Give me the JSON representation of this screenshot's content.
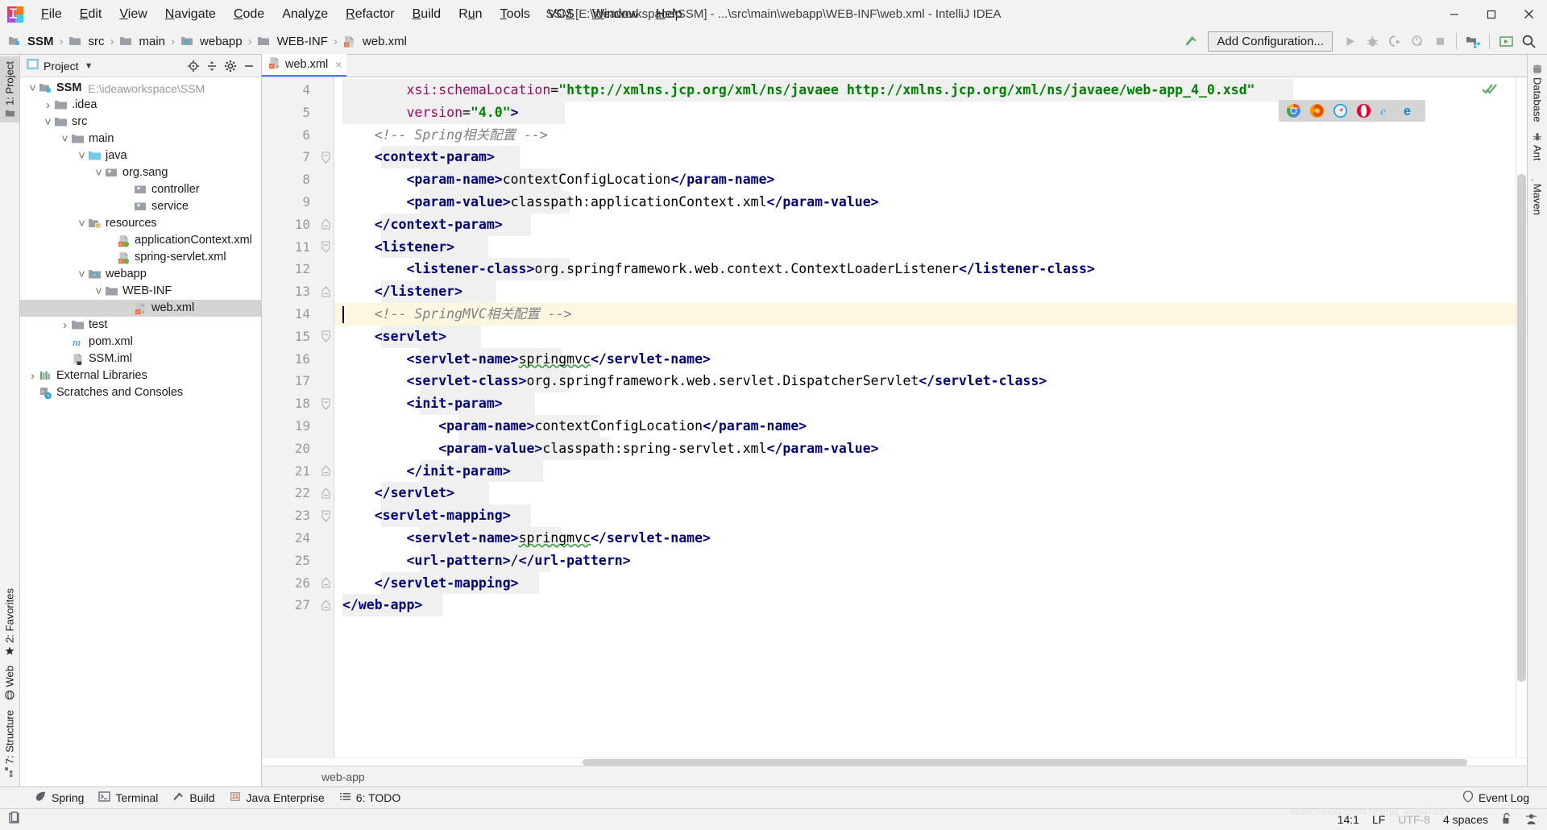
{
  "window": {
    "title": "SSM [E:\\ideaworkspace\\SSM] - ...\\src\\main\\webapp\\WEB-INF\\web.xml - IntelliJ IDEA",
    "minimize_label": "Minimize",
    "maximize_label": "Maximize",
    "close_label": "Close"
  },
  "menu": [
    {
      "label": "File"
    },
    {
      "label": "Edit"
    },
    {
      "label": "View"
    },
    {
      "label": "Navigate"
    },
    {
      "label": "Code"
    },
    {
      "label": "Analyze"
    },
    {
      "label": "Refactor"
    },
    {
      "label": "Build"
    },
    {
      "label": "Run"
    },
    {
      "label": "Tools"
    },
    {
      "label": "VCS"
    },
    {
      "label": "Window"
    },
    {
      "label": "Help"
    }
  ],
  "navbar": {
    "crumbs": [
      {
        "label": "SSM",
        "icon": "module-icon"
      },
      {
        "label": "src",
        "icon": "folder-icon"
      },
      {
        "label": "main",
        "icon": "folder-icon"
      },
      {
        "label": "webapp",
        "icon": "webapp-folder-icon"
      },
      {
        "label": "WEB-INF",
        "icon": "folder-icon"
      },
      {
        "label": "web.xml",
        "icon": "xml-file-icon"
      }
    ],
    "separator": "›",
    "add_configuration": "Add Configuration...",
    "icons": [
      "hammer-build-icon",
      "run-icon",
      "debug-icon",
      "run-coverage-icon",
      "profile-icon",
      "stop-icon",
      "project-structure-icon",
      "update-running-app-icon",
      "search-everywhere-icon"
    ]
  },
  "left_strip": [
    {
      "label": "1: Project",
      "active": true,
      "icon": "project-icon"
    },
    {
      "label": "2: Favorites",
      "active": false,
      "icon": "star-icon"
    },
    {
      "label": "Web",
      "active": false,
      "icon": "web-icon"
    },
    {
      "label": "7: Structure",
      "active": false,
      "icon": "structure-icon"
    }
  ],
  "right_strip": [
    {
      "label": "Database",
      "icon": "database-icon"
    },
    {
      "label": "Ant",
      "icon": "ant-icon"
    },
    {
      "label": "Maven",
      "icon": "maven-icon"
    }
  ],
  "project_panel": {
    "title": "Project",
    "tools": [
      "locate-icon",
      "collapse-all-icon",
      "settings-gear-icon",
      "hide-icon"
    ],
    "tree": [
      {
        "depth": 0,
        "label": "SSM",
        "path": "E:\\ideaworkspace\\SSM",
        "icon": "module-icon",
        "arrow": "expanded",
        "bold": true
      },
      {
        "depth": 1,
        "label": ".idea",
        "icon": "folder-icon",
        "arrow": "collapsed"
      },
      {
        "depth": 1,
        "label": "src",
        "icon": "folder-icon",
        "arrow": "expanded"
      },
      {
        "depth": 2,
        "label": "main",
        "icon": "folder-icon",
        "arrow": "expanded"
      },
      {
        "depth": 3,
        "label": "java",
        "icon": "source-folder-icon",
        "arrow": "expanded"
      },
      {
        "depth": 4,
        "label": "org.sang",
        "icon": "package-icon",
        "arrow": "expanded"
      },
      {
        "depth": 5,
        "label": "controller",
        "icon": "package-icon",
        "arrow": "none"
      },
      {
        "depth": 5,
        "label": "service",
        "icon": "package-icon",
        "arrow": "none"
      },
      {
        "depth": 3,
        "label": "resources",
        "icon": "resources-folder-icon",
        "arrow": "expanded"
      },
      {
        "depth": 4,
        "label": "applicationContext.xml",
        "icon": "spring-xml-icon",
        "arrow": "none"
      },
      {
        "depth": 4,
        "label": "spring-servlet.xml",
        "icon": "spring-xml-icon",
        "arrow": "none"
      },
      {
        "depth": 3,
        "label": "webapp",
        "icon": "webapp-folder-icon",
        "arrow": "expanded"
      },
      {
        "depth": 4,
        "label": "WEB-INF",
        "icon": "folder-icon",
        "arrow": "expanded"
      },
      {
        "depth": 5,
        "label": "web.xml",
        "icon": "web-xml-icon",
        "arrow": "none",
        "selected": true
      },
      {
        "depth": 2,
        "label": "test",
        "icon": "folder-icon",
        "arrow": "collapsed"
      },
      {
        "depth": 1,
        "label": "pom.xml",
        "icon": "maven-pom-icon",
        "arrow": "none"
      },
      {
        "depth": 1,
        "label": "SSM.iml",
        "icon": "iml-file-icon",
        "arrow": "none"
      },
      {
        "depth": 0,
        "label": "External Libraries",
        "icon": "libraries-icon",
        "arrow": "collapsed"
      },
      {
        "depth": 0,
        "label": "Scratches and Consoles",
        "icon": "scratches-icon",
        "arrow": "none"
      }
    ]
  },
  "editor": {
    "tab": {
      "label": "web.xml",
      "icon": "web-xml-icon",
      "close": "×"
    },
    "caret_line": 14,
    "first_line": 4,
    "breadcrumb": "web-app",
    "browser_popup": [
      "chrome-icon",
      "firefox-icon",
      "safari-icon",
      "opera-icon",
      "ie-icon",
      "edge-icon"
    ],
    "inspection_badge": "inspections-ok-icon",
    "lines": [
      {
        "n": 4,
        "fold": "none",
        "indent_hl": [
          0,
          1180
        ],
        "spans": [
          {
            "t": "        ",
            "c": "plain"
          },
          {
            "t": "xsi:schemaLocation",
            "c": "attr"
          },
          {
            "t": "=",
            "c": "plain"
          },
          {
            "t": "\"http://xmlns.jcp.org/xml/ns/javaee http://xmlns.jcp.org/xml/ns/javaee/web-app_4_0.xsd\"",
            "c": "str"
          }
        ]
      },
      {
        "n": 5,
        "fold": "none",
        "indent_hl": [
          0,
          276
        ],
        "spans": [
          {
            "t": "        ",
            "c": "plain"
          },
          {
            "t": "version",
            "c": "attr"
          },
          {
            "t": "=",
            "c": "plain"
          },
          {
            "t": "\"4.0\"",
            "c": "str"
          },
          {
            "t": ">",
            "c": "tag"
          }
        ]
      },
      {
        "n": 6,
        "fold": "none",
        "spans": [
          {
            "t": "    ",
            "c": "plain"
          },
          {
            "t": "<!-- Spring相关配置 -->",
            "c": "comment"
          }
        ]
      },
      {
        "n": 7,
        "fold": "open",
        "indent_hl": [
          48,
          172
        ],
        "spans": [
          {
            "t": "    ",
            "c": "plain"
          },
          {
            "t": "<context-param>",
            "c": "tag"
          }
        ]
      },
      {
        "n": 8,
        "fold": "none",
        "indent_hl": [
          96,
          176
        ],
        "spans": [
          {
            "t": "        ",
            "c": "plain"
          },
          {
            "t": "<param-name>",
            "c": "tag"
          },
          {
            "t": "contextConfigLocation",
            "c": "plain"
          },
          {
            "t": "</param-name>",
            "c": "tag"
          }
        ]
      },
      {
        "n": 9,
        "fold": "none",
        "indent_hl": [
          96,
          186
        ],
        "spans": [
          {
            "t": "        ",
            "c": "plain"
          },
          {
            "t": "<param-value>",
            "c": "tag"
          },
          {
            "t": "classpath:applicationContext.xml",
            "c": "plain"
          },
          {
            "t": "</param-value>",
            "c": "tag"
          }
        ]
      },
      {
        "n": 10,
        "fold": "close",
        "indent_hl": [
          48,
          186
        ],
        "spans": [
          {
            "t": "    ",
            "c": "plain"
          },
          {
            "t": "</context-param>",
            "c": "tag"
          }
        ]
      },
      {
        "n": 11,
        "fold": "open",
        "indent_hl": [
          48,
          133
        ],
        "spans": [
          {
            "t": "    ",
            "c": "plain"
          },
          {
            "t": "<listener>",
            "c": "tag"
          }
        ]
      },
      {
        "n": 12,
        "fold": "none",
        "indent_hl": [
          96,
          186
        ],
        "spans": [
          {
            "t": "        ",
            "c": "plain"
          },
          {
            "t": "<listener-class>",
            "c": "tag"
          },
          {
            "t": "org.springframework.web.context.ContextLoaderListener",
            "c": "plain"
          },
          {
            "t": "</listener-class>",
            "c": "tag"
          }
        ]
      },
      {
        "n": 13,
        "fold": "close",
        "indent_hl": [
          48,
          143
        ],
        "spans": [
          {
            "t": "    ",
            "c": "plain"
          },
          {
            "t": "</listener>",
            "c": "tag"
          }
        ]
      },
      {
        "n": 14,
        "fold": "none",
        "highlight": true,
        "caret": true,
        "spans": [
          {
            "t": "    ",
            "c": "plain"
          },
          {
            "t": "<!-- SpringMVC相关配置 -->",
            "c": "comment"
          }
        ]
      },
      {
        "n": 15,
        "fold": "open",
        "indent_hl": [
          48,
          124
        ],
        "spans": [
          {
            "t": "    ",
            "c": "plain"
          },
          {
            "t": "<servlet>",
            "c": "tag"
          }
        ]
      },
      {
        "n": 16,
        "fold": "none",
        "indent_hl": [
          96,
          176
        ],
        "spans": [
          {
            "t": "        ",
            "c": "plain"
          },
          {
            "t": "<servlet-name>",
            "c": "tag"
          },
          {
            "t": "springmvc",
            "c": "plain sqerr"
          },
          {
            "t": "</servlet-name>",
            "c": "tag"
          }
        ]
      },
      {
        "n": 17,
        "fold": "none",
        "indent_hl": [
          96,
          186
        ],
        "spans": [
          {
            "t": "        ",
            "c": "plain"
          },
          {
            "t": "<servlet-class>",
            "c": "tag"
          },
          {
            "t": "org.springframework.web.servlet.DispatcherServlet",
            "c": "plain"
          },
          {
            "t": "</servlet-class>",
            "c": "tag"
          }
        ]
      },
      {
        "n": 18,
        "fold": "open",
        "indent_hl": [
          96,
          143
        ],
        "spans": [
          {
            "t": "        ",
            "c": "plain"
          },
          {
            "t": "<init-param>",
            "c": "tag"
          }
        ]
      },
      {
        "n": 19,
        "fold": "none",
        "indent_hl": [
          144,
          176
        ],
        "spans": [
          {
            "t": "            ",
            "c": "plain"
          },
          {
            "t": "<param-name>",
            "c": "tag"
          },
          {
            "t": "contextConfigLocation",
            "c": "plain"
          },
          {
            "t": "</param-name>",
            "c": "tag"
          }
        ]
      },
      {
        "n": 20,
        "fold": "none",
        "indent_hl": [
          144,
          186
        ],
        "spans": [
          {
            "t": "            ",
            "c": "plain"
          },
          {
            "t": "<param-value>",
            "c": "tag"
          },
          {
            "t": "classpath:spring-servlet.xml",
            "c": "plain"
          },
          {
            "t": "</param-value>",
            "c": "tag"
          }
        ]
      },
      {
        "n": 21,
        "fold": "close",
        "indent_hl": [
          96,
          153
        ],
        "spans": [
          {
            "t": "        ",
            "c": "plain"
          },
          {
            "t": "</init-param>",
            "c": "tag"
          }
        ]
      },
      {
        "n": 22,
        "fold": "close",
        "indent_hl": [
          48,
          134
        ],
        "spans": [
          {
            "t": "    ",
            "c": "plain"
          },
          {
            "t": "</servlet>",
            "c": "tag"
          }
        ]
      },
      {
        "n": 23,
        "fold": "open",
        "indent_hl": [
          48,
          186
        ],
        "spans": [
          {
            "t": "    ",
            "c": "plain"
          },
          {
            "t": "<servlet-mapping>",
            "c": "tag"
          }
        ]
      },
      {
        "n": 24,
        "fold": "none",
        "indent_hl": [
          96,
          176
        ],
        "spans": [
          {
            "t": "        ",
            "c": "plain"
          },
          {
            "t": "<servlet-name>",
            "c": "tag"
          },
          {
            "t": "springmvc",
            "c": "plain sqerr"
          },
          {
            "t": "</servlet-name>",
            "c": "tag"
          }
        ]
      },
      {
        "n": 25,
        "fold": "none",
        "indent_hl": [
          96,
          162
        ],
        "spans": [
          {
            "t": "        ",
            "c": "plain"
          },
          {
            "t": "<url-pattern>",
            "c": "tag"
          },
          {
            "t": "/",
            "c": "plain"
          },
          {
            "t": "</url-pattern>",
            "c": "tag"
          }
        ]
      },
      {
        "n": 26,
        "fold": "close",
        "indent_hl": [
          48,
          196
        ],
        "spans": [
          {
            "t": "    ",
            "c": "plain"
          },
          {
            "t": "</servlet-mapping>",
            "c": "tag"
          }
        ]
      },
      {
        "n": 27,
        "fold": "close",
        "indent_hl": [
          0,
          124
        ],
        "spans": [
          {
            "t": "</web-app>",
            "c": "tag"
          }
        ]
      }
    ]
  },
  "bottom_tools": [
    {
      "label": "Spring",
      "icon": "spring-leaf-icon"
    },
    {
      "label": "Terminal",
      "icon": "terminal-icon"
    },
    {
      "label": "Build",
      "icon": "hammer-build-icon"
    },
    {
      "label": "Java Enterprise",
      "icon": "java-enterprise-icon"
    },
    {
      "label": "6: TODO",
      "icon": "todo-icon"
    }
  ],
  "event_log": {
    "label": "Event Log",
    "icon": "event-log-icon"
  },
  "statusbar": {
    "left_icon": "memory-indicator-icon",
    "position": "14:1",
    "line_separator": "LF",
    "encoding": "UTF-8",
    "indent": "4 spaces",
    "lock_icon": "unlocked-icon",
    "hector_icon": "inspection-level-icon"
  },
  "watermark": "https://blog.csdn.net/qq_43647356",
  "colors": {
    "accent_blue": "#3d7ef7",
    "tag": "#000080",
    "string": "#008000",
    "attribute": "#9e0b5e",
    "comment": "#808080",
    "caret_line": "#fdf7e2",
    "selection": "#d4d4d4"
  }
}
